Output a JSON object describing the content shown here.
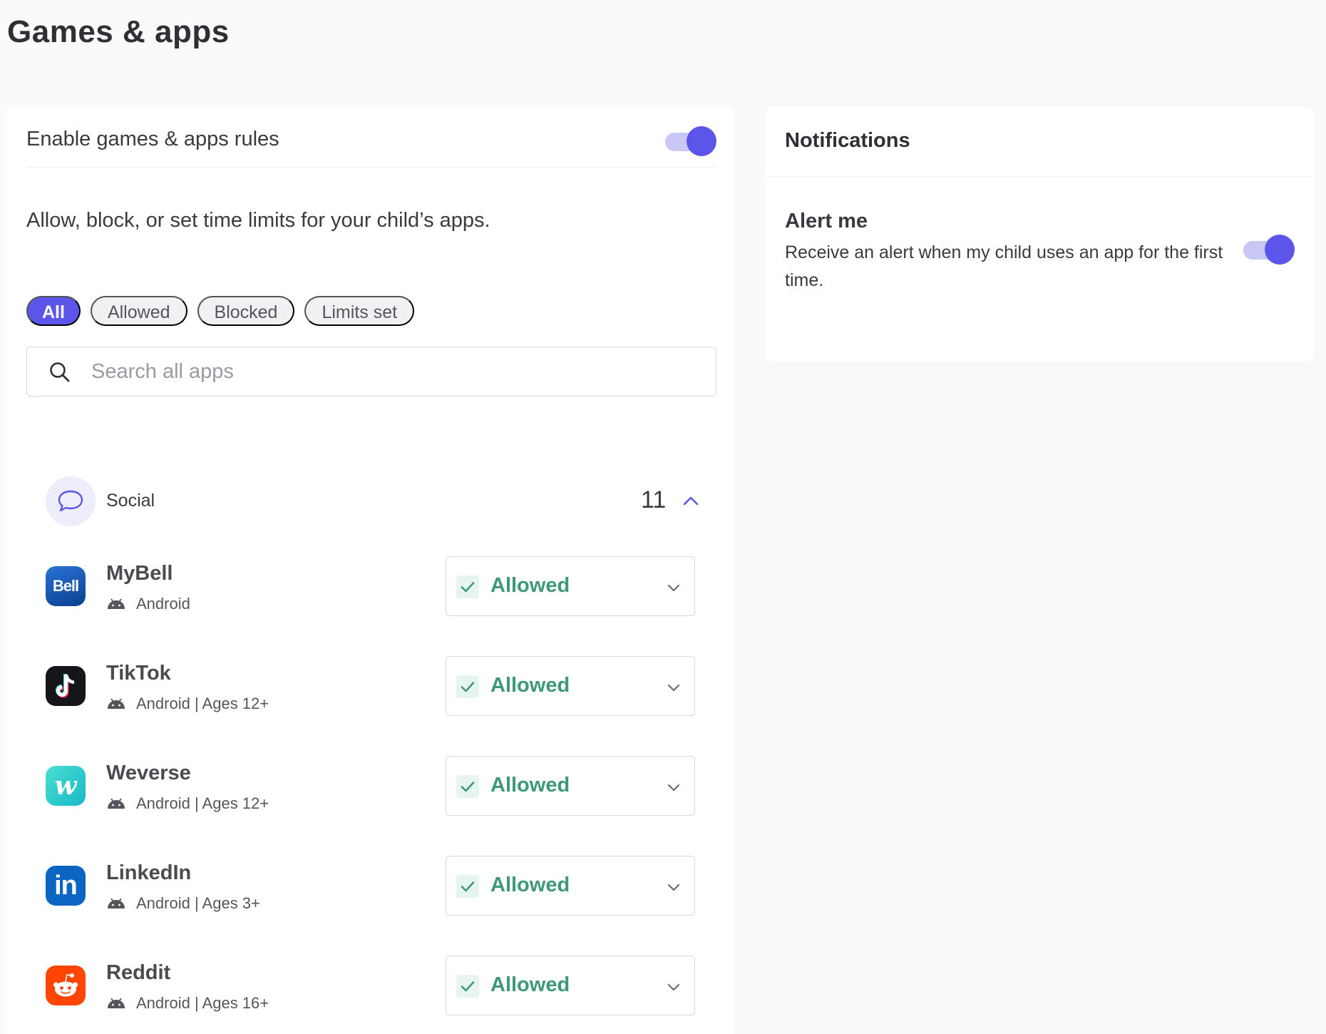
{
  "page": {
    "title": "Games & apps"
  },
  "rules": {
    "enable_label": "Enable games & apps rules",
    "enabled": true,
    "description": "Allow, block, or set time limits for your child’s apps."
  },
  "filters": {
    "chips": [
      {
        "label": "All",
        "active": true
      },
      {
        "label": "Allowed",
        "active": false
      },
      {
        "label": "Blocked",
        "active": false
      },
      {
        "label": "Limits set",
        "active": false
      }
    ]
  },
  "search": {
    "placeholder": "Search all apps",
    "value": ""
  },
  "category": {
    "label": "Social",
    "count": "11",
    "expanded": true,
    "icon": "chat-bubble-icon"
  },
  "apps": [
    {
      "name": "MyBell",
      "meta": "Android",
      "status": "Allowed",
      "icon": "mybell-app-icon"
    },
    {
      "name": "TikTok",
      "meta": "Android | Ages 12+",
      "status": "Allowed",
      "icon": "tiktok-app-icon"
    },
    {
      "name": "Weverse",
      "meta": "Android | Ages 12+",
      "status": "Allowed",
      "icon": "weverse-app-icon"
    },
    {
      "name": "LinkedIn",
      "meta": "Android | Ages 3+",
      "status": "Allowed",
      "icon": "linkedin-app-icon"
    },
    {
      "name": "Reddit",
      "meta": "Android | Ages 16+",
      "status": "Allowed",
      "icon": "reddit-app-icon"
    }
  ],
  "notifications": {
    "title": "Notifications",
    "alert_title": "Alert me",
    "alert_description": "Receive an alert when my child uses an app for the first time.",
    "alert_enabled": true
  },
  "colors": {
    "accent": "#5b55ea",
    "accent_light": "#c9c7f5",
    "allowed_green": "#3e9977",
    "allowed_bg": "#e7f5ef",
    "page_bg": "#fafafa",
    "card_bg": "#ffffff"
  }
}
